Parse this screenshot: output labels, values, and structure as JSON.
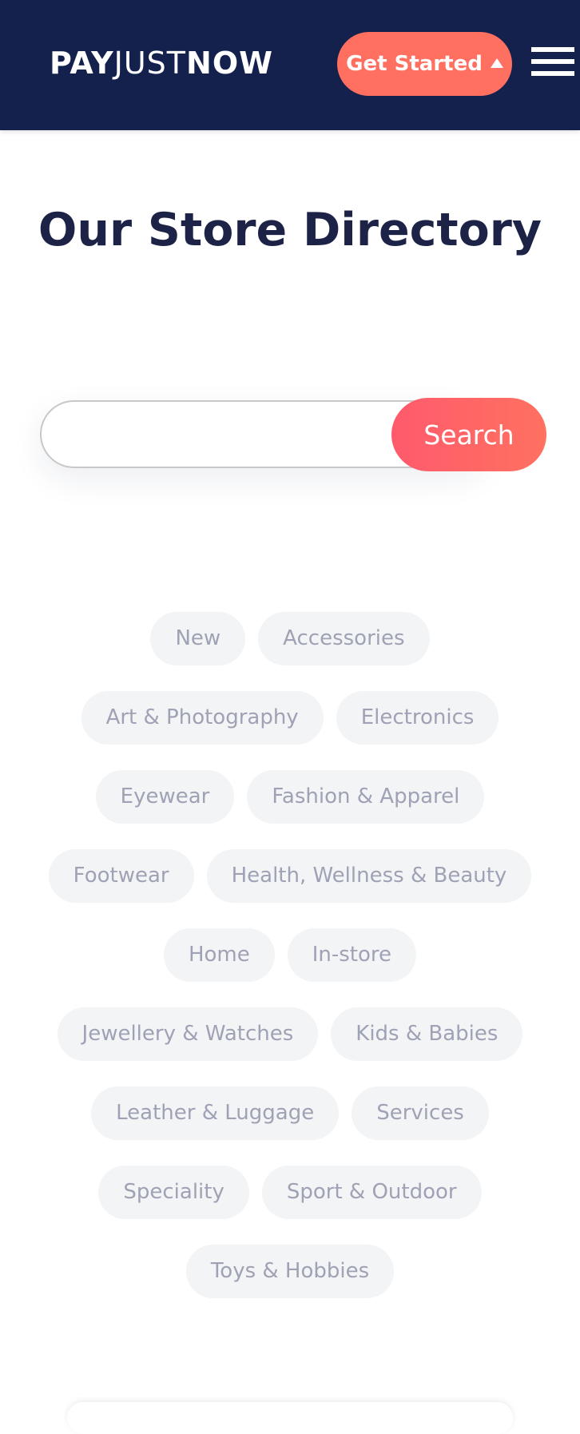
{
  "header": {
    "logo_pay": "PAY",
    "logo_just": "JUST",
    "logo_now": "NOW",
    "cta_label": "Get Started"
  },
  "main": {
    "title": "Our Store Directory",
    "search": {
      "value": "",
      "placeholder": "",
      "button_label": "Search"
    },
    "categories": [
      "New",
      "Accessories",
      "Art & Photography",
      "Electronics",
      "Eyewear",
      "Fashion & Apparel",
      "Footwear",
      "Health, Wellness & Beauty",
      "Home",
      "In-store",
      "Jewellery & Watches",
      "Kids & Babies",
      "Leather & Luggage",
      "Services",
      "Speciality",
      "Sport & Outdoor",
      "Toys & Hobbies"
    ]
  },
  "colors": {
    "header_bg": "#14214d",
    "accent": "#ff7060",
    "title": "#1d2347",
    "tag_bg": "#f3f4f6",
    "tag_text": "#9ea2b4"
  },
  "icons": {
    "menu": "hamburger-menu-icon",
    "cta_arrow": "triangle-up-icon"
  }
}
